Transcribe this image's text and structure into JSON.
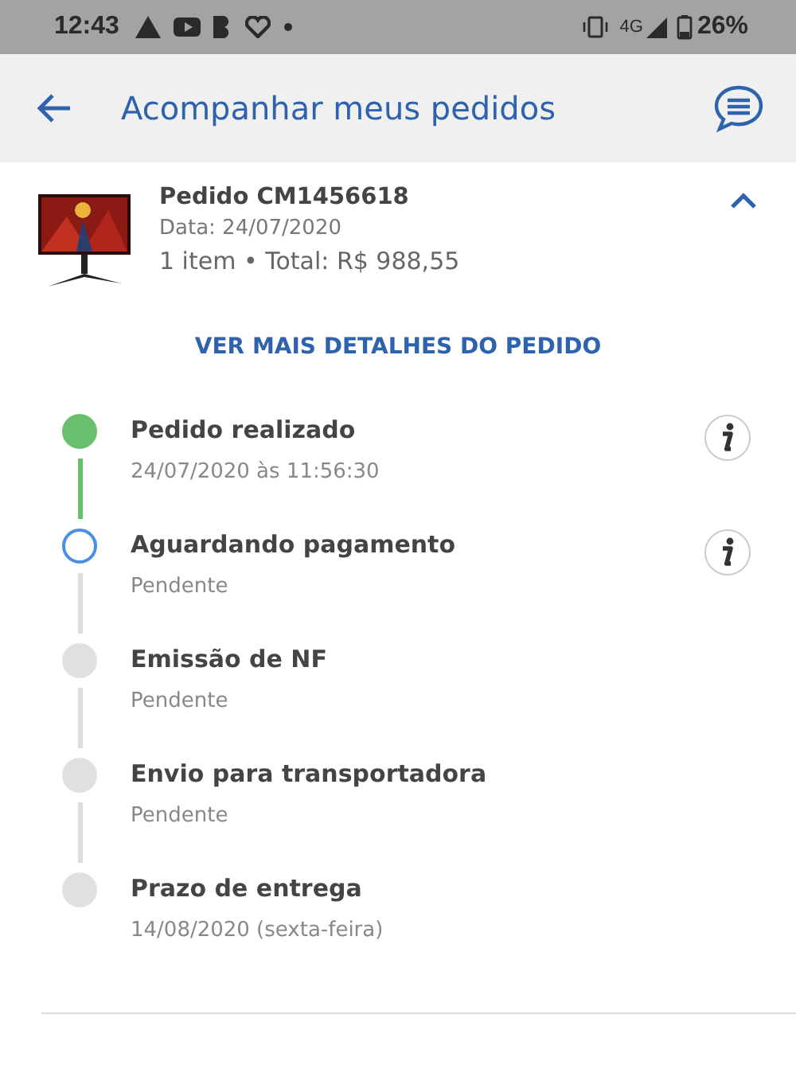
{
  "status_bar": {
    "time": "12:43",
    "network": "4G",
    "battery": "26%"
  },
  "header": {
    "title": "Acompanhar meus pedidos"
  },
  "order": {
    "kind": "picture",
    "number": "Pedido CM1456618",
    "date": "Data: 24/07/2020",
    "summary": "1 item • Total: R$ 988,55",
    "expanded": true
  },
  "details_link": "VER MAIS DETALHES DO PEDIDO",
  "timeline": [
    {
      "title": "Pedido realizado",
      "detail": "24/07/2020 às 11:56:30",
      "kind": "done",
      "info": true
    },
    {
      "title": "Aguardando pagamento",
      "detail": "Pendente",
      "kind": "current",
      "info": true
    },
    {
      "title": "Emissão de NF",
      "detail": "Pendente",
      "kind": "pending",
      "info": false
    },
    {
      "title": "Envio para transportadora",
      "detail": "Pendente",
      "kind": "pending",
      "info": false
    },
    {
      "title": "Prazo de entrega",
      "detail": "14/08/2020 (sexta-feira)",
      "kind": "pending",
      "info": false
    }
  ]
}
